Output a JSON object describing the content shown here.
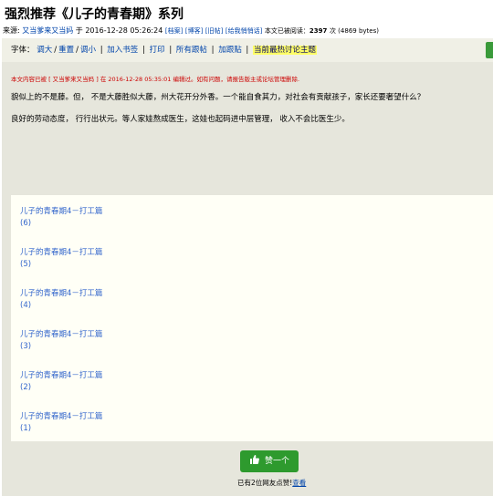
{
  "page": {
    "title": "强烈推荐《儿子的青春期》系列"
  },
  "meta": {
    "source_label": "来源:",
    "author": "又当爹来又当妈",
    "at_label": "于",
    "datetime": "2016-12-28 05:26:24",
    "links": [
      "[档案]",
      "[博客]",
      "[旧帖]",
      "[给我悄悄话]"
    ],
    "reads_label": "本文已被阅读：",
    "reads_count": "2397",
    "reads_suffix": "次 (4869 bytes)"
  },
  "toolbar": {
    "font_label": "字体：",
    "font_larger": "调大",
    "font_reset": "重置",
    "font_smaller": "调小",
    "bookmark": "加入书签",
    "print": "打印",
    "all_replies": "所有跟帖",
    "add_reply": "加跟贴",
    "hot_topic": "当前最热讨论主题"
  },
  "content": {
    "edit_note": "本文内容已被 [ 又当爹来又当妈 ] 在 2016-12-28 05:35:01 编辑过。如有问题，请报告版主或论坛管理删除.",
    "para1": "貌似上的不是藤。但， 不是大藤胜似大藤，州大花开分外香。一个能自食其力，对社会有贡献孩子，家长还要奢望什么？",
    "para2": "良好的劳动态度， 行行出状元。等人家娃熬成医生，这娃也起码进中层管理， 收入不会比医生少。"
  },
  "related": [
    {
      "title": "儿子的青春期4－打工篇",
      "num": "(6)"
    },
    {
      "title": "儿子的青春期4－打工篇",
      "num": "(5)"
    },
    {
      "title": "儿子的青春期4－打工篇",
      "num": "(4)"
    },
    {
      "title": "儿子的青春期4－打工篇",
      "num": "(3)"
    },
    {
      "title": "儿子的青春期4－打工篇",
      "num": "(2)"
    },
    {
      "title": "儿子的青春期4－打工篇",
      "num": "(1)"
    }
  ],
  "like": {
    "button_label": "赞一个",
    "note_prefix": "已有2位网友点赞!",
    "note_link": "查看"
  },
  "colors": {
    "link": "#0044aa",
    "panel_bg": "#e6e6dc",
    "like_green": "#2e9a2e",
    "edit_red": "#cc0000",
    "highlight": "#ffff66"
  }
}
